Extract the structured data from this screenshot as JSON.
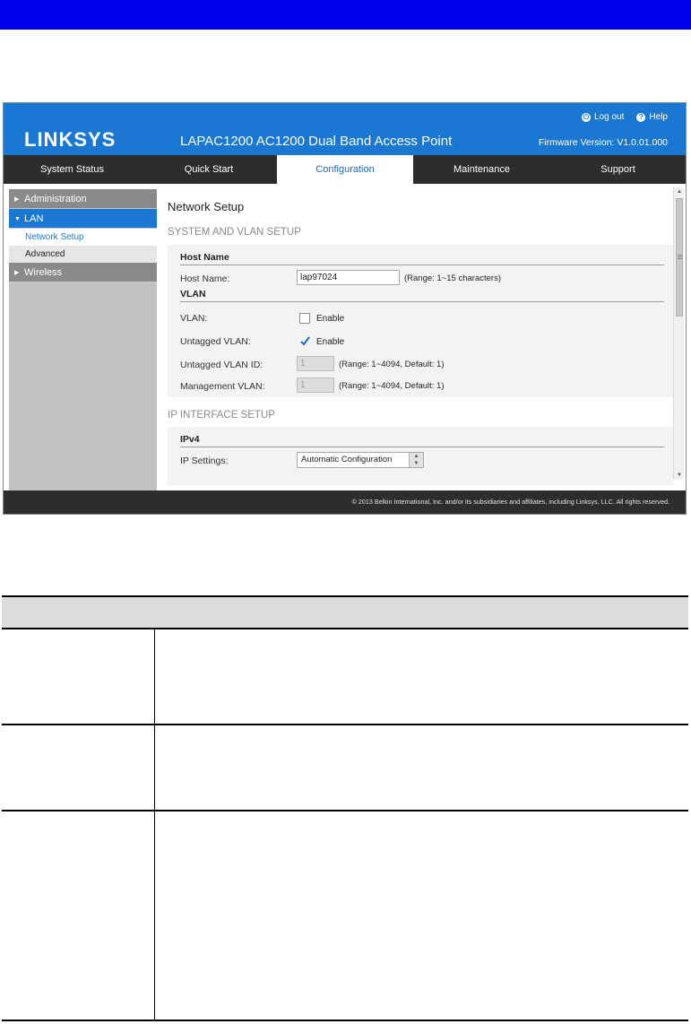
{
  "app": {
    "brand": "LINKSYS",
    "product": "LAPAC1200 AC1200 Dual Band Access Point",
    "logout": "Log out",
    "help": "Help",
    "firmware": "Firmware Version: V1.0.01.000",
    "brand_color": "#1a78d3"
  },
  "nav": {
    "tabs": [
      {
        "label": "System Status"
      },
      {
        "label": "Quick Start"
      },
      {
        "label": "Configuration"
      },
      {
        "label": "Maintenance"
      },
      {
        "label": "Support"
      }
    ],
    "active": "Configuration"
  },
  "sidebar": {
    "items": [
      {
        "label": "Administration"
      },
      {
        "label": "LAN"
      },
      {
        "label": "Wireless"
      }
    ],
    "sub": [
      {
        "label": "Network Setup"
      },
      {
        "label": "Advanced"
      }
    ]
  },
  "main": {
    "title": "Network Setup",
    "system_section": "SYSTEM AND VLAN SETUP",
    "host_group": "Host Name",
    "host_label": "Host Name:",
    "host_value": "lap97024",
    "host_hint": "(Range: 1~15 characters)",
    "vlan_group": "VLAN",
    "vlan_label": "VLAN:",
    "vlan_enable": "Enable",
    "vlan_checked": false,
    "untagged_label": "Untagged VLAN:",
    "untagged_enable": "Enable",
    "untagged_checked": true,
    "untagged_id_label": "Untagged VLAN ID:",
    "untagged_id_value": "1",
    "untagged_id_hint": "(Range: 1~4094, Default: 1)",
    "mgmt_label": "Management VLAN:",
    "mgmt_value": "1",
    "mgmt_hint": "(Range: 1~4094, Default: 1)",
    "ip_section": "IP INTERFACE SETUP",
    "ipv4_group": "IPv4",
    "ip_settings_label": "IP Settings:",
    "ip_settings_value": "Automatic Configuration"
  },
  "footer": {
    "copyright": "© 2013 Belkin International, Inc. and/or its subsidiaries and affiliates, including Linksys, LLC. All rights reserved."
  }
}
